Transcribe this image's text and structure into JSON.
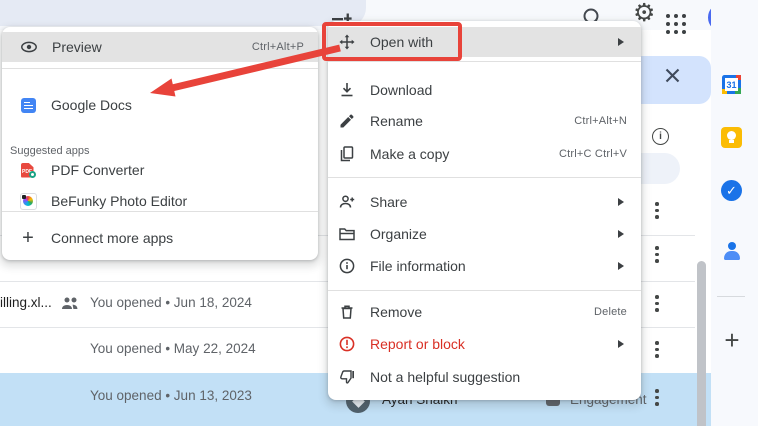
{
  "colors": {
    "annotation_red": "#e8433a",
    "danger_text": "#d93025",
    "selected_row_bg": "#c2e0f6",
    "selection_bar_bg": "#d3e3fd"
  },
  "submenu": {
    "items": [
      {
        "label": "Preview",
        "shortcut": "Ctrl+Alt+P"
      },
      {
        "label": "Google Docs"
      },
      {
        "label": "PDF Converter"
      },
      {
        "label": "BeFunky Photo Editor"
      },
      {
        "label": "Connect more apps"
      }
    ],
    "section_label": "Suggested apps"
  },
  "menu": {
    "items": [
      {
        "label": "Open with"
      },
      {
        "label": "Download"
      },
      {
        "label": "Rename",
        "shortcut": "Ctrl+Alt+N"
      },
      {
        "label": "Make a copy",
        "shortcut": "Ctrl+C Ctrl+V"
      },
      {
        "label": "Share"
      },
      {
        "label": "Organize"
      },
      {
        "label": "File information"
      },
      {
        "label": "Remove",
        "shortcut": "Delete"
      },
      {
        "label": "Report or block"
      },
      {
        "label": "Not a helpful suggestion"
      }
    ]
  },
  "file_list": {
    "rows": [
      {
        "name": "illing.xl...",
        "activity": "You opened • Jun 18, 2024"
      },
      {
        "activity": "You opened • May 22, 2024"
      },
      {
        "activity": "You opened • Jun 13, 2023",
        "owner": "Ayan Shaikh",
        "reason": "Engagement"
      }
    ]
  },
  "sidebar": {
    "calendar_label": "31",
    "tasks_check": "✓"
  }
}
